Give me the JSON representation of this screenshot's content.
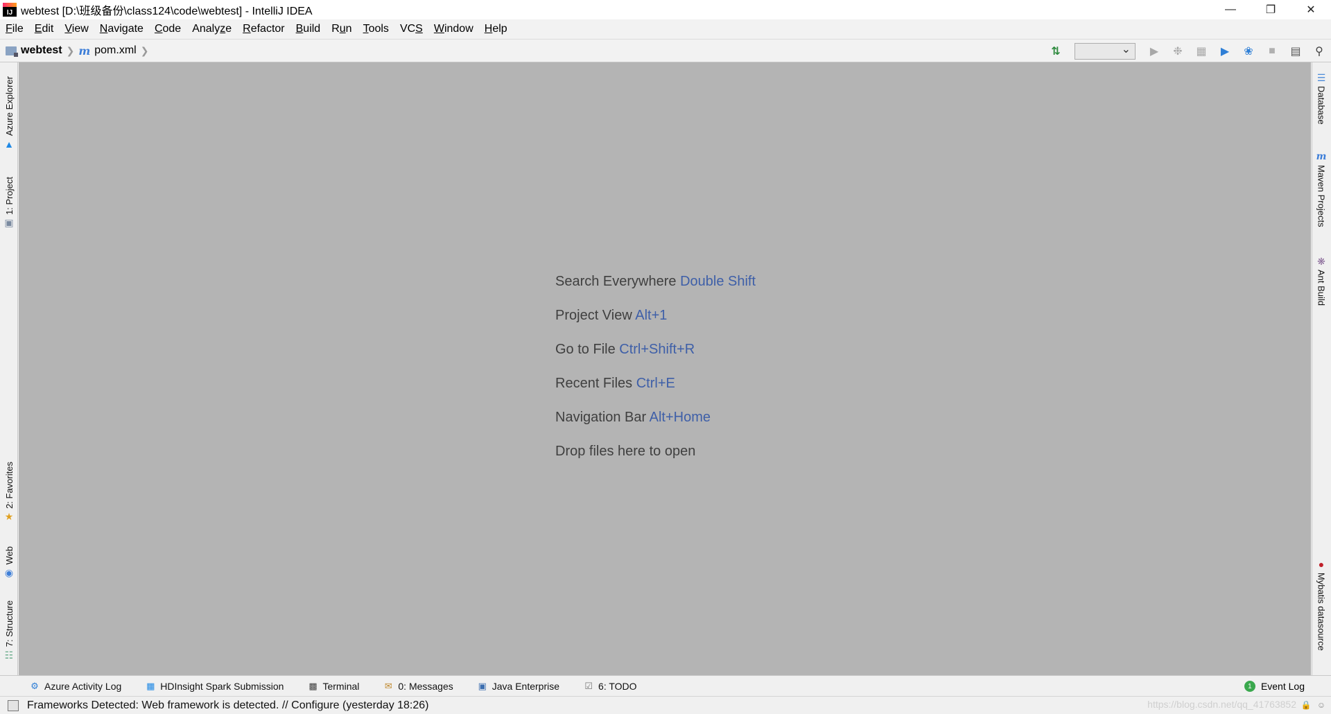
{
  "window": {
    "title": "webtest [D:\\班级备份\\class124\\code\\webtest] - IntelliJ IDEA",
    "app_icon": "intellij-idea-icon",
    "controls": [
      "minimize-icon",
      "restore-icon",
      "close-icon"
    ]
  },
  "menu": {
    "items": [
      {
        "mn": "F",
        "rest": "ile"
      },
      {
        "mn": "E",
        "rest": "dit"
      },
      {
        "mn": "V",
        "rest": "iew"
      },
      {
        "mn": "N",
        "rest": "avigate"
      },
      {
        "mn": "C",
        "rest": "ode"
      },
      {
        "pre": "Analy",
        "mn": "z",
        "rest": "e"
      },
      {
        "mn": "R",
        "rest": "efactor"
      },
      {
        "mn": "B",
        "rest": "uild"
      },
      {
        "pre": "R",
        "mn": "u",
        "rest": "n"
      },
      {
        "mn": "T",
        "rest": "ools"
      },
      {
        "pre": "VC",
        "mn": "S",
        "rest": ""
      },
      {
        "mn": "W",
        "rest": "indow"
      },
      {
        "mn": "H",
        "rest": "elp"
      }
    ]
  },
  "navbar": {
    "project": "webtest",
    "file": "pom.xml",
    "run_config_value": ""
  },
  "left_tools": [
    {
      "label": "Azure Explorer"
    },
    {
      "label": "1: Project"
    },
    {
      "label": "2: Favorites"
    },
    {
      "label": "Web"
    },
    {
      "label": "7: Structure"
    }
  ],
  "right_tools": [
    {
      "label": "Database"
    },
    {
      "label": "Maven Projects"
    },
    {
      "label": "Ant Build"
    },
    {
      "label": "Mybatis datasource"
    }
  ],
  "editor": {
    "hints": [
      {
        "text": "Search Everywhere",
        "shortcut": "Double Shift"
      },
      {
        "text": "Project View",
        "shortcut": "Alt+1"
      },
      {
        "text": "Go to File",
        "shortcut": "Ctrl+Shift+R"
      },
      {
        "text": "Recent Files",
        "shortcut": "Ctrl+E"
      },
      {
        "text": "Navigation Bar",
        "shortcut": "Alt+Home"
      },
      {
        "text": "Drop files here to open",
        "shortcut": ""
      }
    ]
  },
  "bottom_tools": [
    {
      "label": "Azure Activity Log"
    },
    {
      "label": "HDInsight Spark Submission"
    },
    {
      "label": "Terminal"
    },
    {
      "label": "0: Messages"
    },
    {
      "label": "Java Enterprise"
    },
    {
      "label": "6: TODO"
    }
  ],
  "event_log": {
    "label": "Event Log",
    "count": "1"
  },
  "status": {
    "message": "Frameworks Detected: Web framework is detected. // Configure (yesterday 18:26)",
    "watermark": "https://blog.csdn.net/qq_41763852"
  },
  "colors": {
    "editor_bg": "#b4b4b4",
    "shortcut": "#3e5fa8",
    "hint_text": "#3f3f3f"
  }
}
